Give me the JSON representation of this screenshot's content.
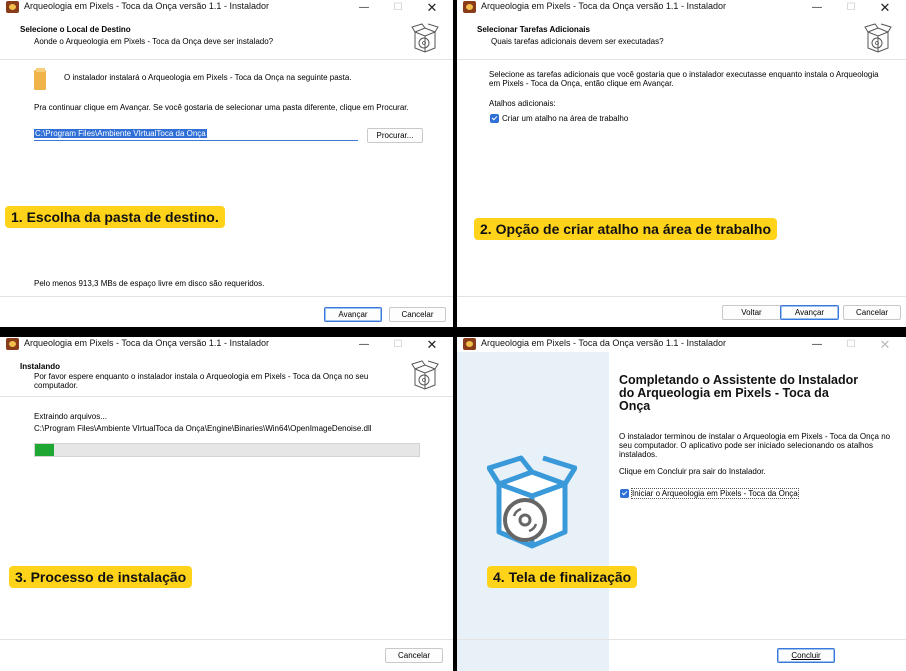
{
  "app_title": "Arqueologia em Pixels - Toca da Onça versão 1.1 - Instalador",
  "controls": {
    "minimize": "—",
    "maximize": "☐",
    "close": "✕"
  },
  "w1": {
    "header_title": "Selecione o Local de Destino",
    "header_sub": "Aonde o Arqueologia em Pixels - Toca da Onça deve ser instalado?",
    "info": "O instalador instalará o Arqueologia em Pixels - Toca da Onça na seguinte pasta.",
    "instruction": "Pra continuar clique em Avançar. Se você gostaria de selecionar uma pasta diferente, clique em Procurar.",
    "path_value": "C:\\Program Files\\Ambiente VIrtualToca da Onça",
    "browse": "Procurar...",
    "space": "Pelo menos 913,3 MBs de espaço livre em disco são requeridos.",
    "next": "Avançar",
    "cancel": "Cancelar",
    "caption": "1. Escolha da pasta de destino."
  },
  "w2": {
    "header_title": "Selecionar Tarefas Adicionais",
    "header_sub": "Quais tarefas adicionais devem ser executadas?",
    "info_line1": "Selecione as tarefas adicionais que você gostaria que o instalador executasse enquanto instala o Arqueologia",
    "info_line2": "em Pixels - Toca da Onça, então clique em Avançar.",
    "shortcuts_label": "Atalhos adicionais:",
    "checkbox_label": "Criar um atalho na área de trabalho",
    "back": "Voltar",
    "next": "Avançar",
    "cancel": "Cancelar",
    "caption": "2. Opção de criar atalho na área de trabalho"
  },
  "w3": {
    "header_title": "Instalando",
    "header_sub_line1": "Por favor espere enquanto o instalador instala o Arqueologia em Pixels - Toca da Onça no seu",
    "header_sub_line2": "computador.",
    "status": "Extraindo arquivos...",
    "file": "C:\\Program Files\\Ambiente VIrtualToca da Onça\\Engine\\Binaries\\Win64\\OpenImageDenoise.dll",
    "progress": 0.05,
    "cancel": "Cancelar",
    "caption": "3. Processo de instalação"
  },
  "w4": {
    "title_line1": "Completando o Assistente do Instalador",
    "title_line2": "do Arqueologia em Pixels - Toca da",
    "title_line3": "Onça",
    "body_line1": "O instalador terminou de instalar o Arqueologia em Pixels - Toca da Onça no",
    "body_line2": "seu computador. O aplicativo pode ser iniciado selecionando os atalhos",
    "body_line3": "instalados.",
    "click_info": "Clique em Concluir pra sair do Instalador.",
    "checkbox_label": "Iniciar o Arqueologia em Pixels - Toca da Onça",
    "finish": "Concluir",
    "caption": "4. Tela de finalização"
  },
  "colors": {
    "accent": "#2f6fd6",
    "progress": "#1fa733",
    "caption_bg": "#ffd31a",
    "side_panel": "#e8f1f8"
  }
}
